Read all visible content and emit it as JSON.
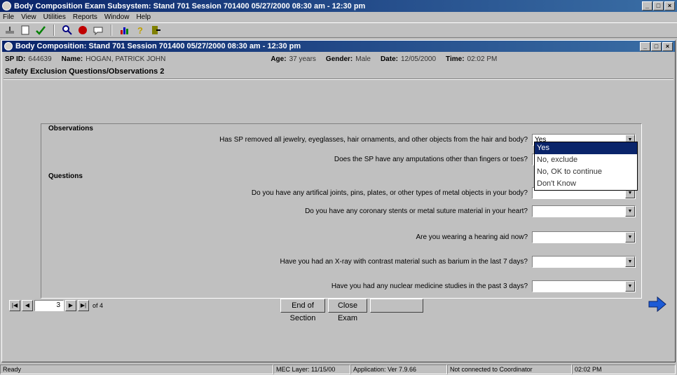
{
  "app": {
    "title": "Body Composition Exam Subsystem: Stand 701 Session 701400 05/27/2000 08:30 am - 12:30 pm",
    "menu": [
      "File",
      "View",
      "Utilities",
      "Reports",
      "Window",
      "Help"
    ]
  },
  "child": {
    "title": "Body Composition: Stand 701 Session 701400 05/27/2000 08:30 am - 12:30 pm"
  },
  "info": {
    "sp_id_label": "SP ID:",
    "sp_id": "644639",
    "name_label": "Name:",
    "name": "HOGAN, PATRICK JOHN",
    "age_label": "Age:",
    "age": "37 years",
    "gender_label": "Gender:",
    "gender": "Male",
    "date_label": "Date:",
    "date": "12/05/2000",
    "time_label": "Time:",
    "time": "02:02 PM"
  },
  "section_title": "Safety Exclusion Questions/Observations 2",
  "observations": {
    "heading": "Observations",
    "q1": "Has SP removed all jewelry, eyeglasses, hair ornaments, and other objects from the hair and body?",
    "q1_value": "Yes",
    "q2": "Does the SP have any amputations other than fingers or toes?"
  },
  "questions": {
    "heading": "Questions",
    "q3": "Do you have any artifical joints, pins, plates, or other types of metal objects in your body?",
    "q4": "Do you have any coronary stents or metal suture material in your heart?",
    "q5": "Are you wearing a hearing aid now?",
    "q6": "Have you had an X-ray with contrast material such as barium in the last 7 days?",
    "q7": "Have you had any nuclear medicine studies in the past 3 days?"
  },
  "dropdown_options": [
    "Yes",
    "No, exclude",
    "No, OK to continue",
    "Don't Know"
  ],
  "nav": {
    "page": "3",
    "of": "of 4"
  },
  "buttons": {
    "end_of_section": "End of Section",
    "close_exam": "Close Exam",
    "disabled": ""
  },
  "status": {
    "ready": "Ready",
    "mec_layer": "MEC Layer: 11/15/00",
    "application": "Application: Ver 7.9.66",
    "coordinator": "Not connected to Coordinator",
    "clock": "02:02 PM"
  }
}
